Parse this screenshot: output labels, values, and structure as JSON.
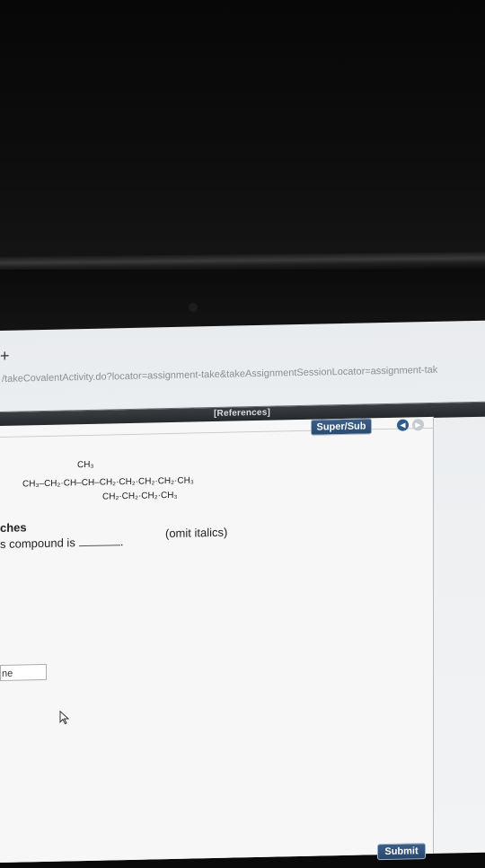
{
  "browser": {
    "tab_glyph": "+",
    "url": "/takeCovalentActivity.do?locator=assignment-take&takeAssignmentSessionLocator=assignment-tak"
  },
  "header": {
    "references_label": "[References]"
  },
  "toolbar": {
    "supersub_label": "Super/Sub",
    "prev_icon": "arrow-left-icon",
    "next_icon": "arrow-right-icon"
  },
  "chemistry": {
    "branch_top": "CH₃",
    "main_chain": "CH₃–CH₂·CH–CH–CH₂·CH₂·CH₂·CH₂·CH₃",
    "branch_bottom": "CH₂·CH₂·CH₂·CH₃"
  },
  "question": {
    "heading_fragment": "ches",
    "prompt_fragment": "s compound is",
    "note": "(omit italics)"
  },
  "answer": {
    "value": "ne"
  },
  "footer": {
    "submit_label": "Submit"
  }
}
